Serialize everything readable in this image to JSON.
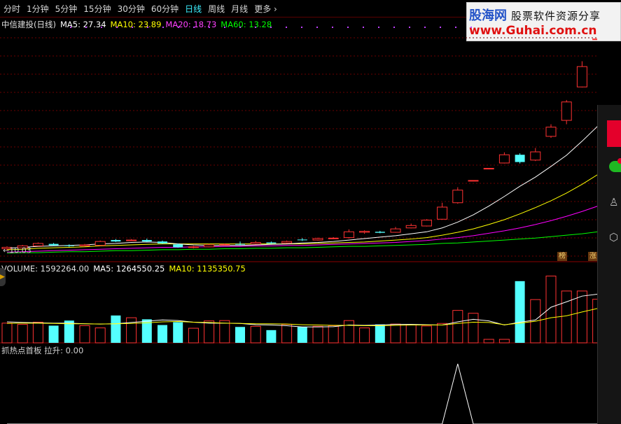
{
  "toolbar": {
    "items": [
      {
        "label": "分时",
        "active": false
      },
      {
        "label": "1分钟",
        "active": false
      },
      {
        "label": "5分钟",
        "active": false
      },
      {
        "label": "15分钟",
        "active": false
      },
      {
        "label": "30分钟",
        "active": false
      },
      {
        "label": "60分钟",
        "active": false
      },
      {
        "label": "日线",
        "active": true
      },
      {
        "label": "周线",
        "active": false
      },
      {
        "label": "月线",
        "active": false
      },
      {
        "label": "更多",
        "active": false
      }
    ]
  },
  "price_panel": {
    "title": "中信建投(日线)",
    "ma5": "MA5: 27.34",
    "ma10": "MA10: 23.89",
    "ma20": "MA20: 18.73",
    "ma60": "MA60: 13.28",
    "low_marker": "←10.03",
    "badges": [
      "榜",
      "涨"
    ]
  },
  "volume_panel": {
    "label": "VOLUME: 1592264.00",
    "ma5": "MA5: 1264550.25",
    "ma10": "MA10: 1135350.75"
  },
  "indicator_panel": {
    "title": "抓热点首板",
    "value": "拉升: 0.00"
  },
  "watermark": {
    "brand": "股海网",
    "subtitle": "股票软件资源分享",
    "url": "www.Guhai.com.cn"
  },
  "colors": {
    "up": "#ff3232",
    "down": "#54ffff",
    "ma5": "#ffffff",
    "ma10": "#ffff00",
    "ma20": "#ff00ff",
    "ma60": "#00ff00",
    "active_tab": "#3cf0ff"
  },
  "chart_data": {
    "type": "candlestick",
    "low_label": 10.03,
    "candles": [
      {
        "o": 10.3,
        "c": 10.6,
        "h": 10.8,
        "l": 10.03
      },
      {
        "o": 10.5,
        "c": 10.9,
        "h": 11.1,
        "l": 10.4
      },
      {
        "o": 10.9,
        "c": 11.4,
        "h": 11.6,
        "l": 10.8
      },
      {
        "o": 11.3,
        "c": 11.0,
        "h": 11.5,
        "l": 10.9
      },
      {
        "o": 11.0,
        "c": 10.9,
        "h": 11.2,
        "l": 10.7
      },
      {
        "o": 10.9,
        "c": 11.1,
        "h": 11.3,
        "l": 10.8
      },
      {
        "o": 11.0,
        "c": 11.8,
        "h": 12.0,
        "l": 10.9
      },
      {
        "o": 12.1,
        "c": 11.8,
        "h": 12.3,
        "l": 11.7
      },
      {
        "o": 12.0,
        "c": 12.1,
        "h": 12.3,
        "l": 11.9
      },
      {
        "o": 12.1,
        "c": 11.8,
        "h": 12.4,
        "l": 11.7
      },
      {
        "o": 11.8,
        "c": 11.4,
        "h": 12.0,
        "l": 11.3
      },
      {
        "o": 11.2,
        "c": 10.6,
        "h": 11.4,
        "l": 10.5
      },
      {
        "o": 10.6,
        "c": 10.7,
        "h": 10.9,
        "l": 10.4
      },
      {
        "o": 10.7,
        "c": 11.1,
        "h": 11.3,
        "l": 10.6
      },
      {
        "o": 11.1,
        "c": 11.2,
        "h": 11.4,
        "l": 11.0
      },
      {
        "o": 11.3,
        "c": 11.2,
        "h": 11.8,
        "l": 11.0
      },
      {
        "o": 11.3,
        "c": 11.6,
        "h": 11.9,
        "l": 11.2
      },
      {
        "o": 11.6,
        "c": 11.4,
        "h": 11.8,
        "l": 11.3
      },
      {
        "o": 11.5,
        "c": 11.8,
        "h": 12.0,
        "l": 11.4
      },
      {
        "o": 12.2,
        "c": 12.1,
        "h": 12.5,
        "l": 11.9
      },
      {
        "o": 12.1,
        "c": 12.4,
        "h": 12.6,
        "l": 12.0
      },
      {
        "o": 12.4,
        "c": 12.5,
        "h": 12.7,
        "l": 12.3
      },
      {
        "o": 12.6,
        "c": 13.8,
        "h": 14.3,
        "l": 12.4
      },
      {
        "o": 13.7,
        "c": 13.9,
        "h": 14.1,
        "l": 13.4
      },
      {
        "o": 13.8,
        "c": 13.6,
        "h": 14.0,
        "l": 13.5
      },
      {
        "o": 13.7,
        "c": 14.4,
        "h": 14.8,
        "l": 13.6
      },
      {
        "o": 14.6,
        "c": 15.1,
        "h": 15.5,
        "l": 14.5
      },
      {
        "o": 15.0,
        "c": 16.2,
        "h": 16.4,
        "l": 14.9
      },
      {
        "o": 16.4,
        "c": 18.9,
        "h": 19.8,
        "l": 16.3
      },
      {
        "o": 19.8,
        "c": 22.4,
        "h": 23.0,
        "l": 19.6
      },
      {
        "o": 24.4,
        "c": 24.4,
        "h": 24.4,
        "l": 24.4
      },
      {
        "o": 26.9,
        "c": 26.9,
        "h": 26.9,
        "l": 26.9
      },
      {
        "o": 28.0,
        "c": 29.7,
        "h": 30.2,
        "l": 27.9
      },
      {
        "o": 29.7,
        "c": 28.2,
        "h": 30.0,
        "l": 27.9
      },
      {
        "o": 28.6,
        "c": 30.3,
        "h": 31.1,
        "l": 28.4
      },
      {
        "o": 33.5,
        "c": 35.4,
        "h": 36.0,
        "l": 33.2
      },
      {
        "o": 36.8,
        "c": 40.6,
        "h": 41.0,
        "l": 36.0
      },
      {
        "o": 43.7,
        "c": 47.9,
        "h": 49.0,
        "l": 43.6
      },
      {
        "o": 53.6,
        "c": 53.6,
        "h": 53.6,
        "l": 50.5
      },
      {
        "o": 50.5,
        "c": 50.5,
        "h": 50.5,
        "l": 43.0
      }
    ],
    "ma5": [
      10.4,
      10.6,
      10.8,
      10.9,
      11.0,
      11.1,
      11.3,
      11.4,
      11.6,
      11.7,
      11.6,
      11.3,
      11.1,
      11.0,
      11.0,
      11.0,
      11.1,
      11.2,
      11.3,
      11.5,
      11.6,
      11.8,
      12.1,
      12.4,
      12.7,
      13.0,
      13.4,
      13.8,
      14.6,
      15.8,
      17.3,
      19.1,
      21.1,
      23.2,
      25.1,
      27.3,
      29.6,
      32.5,
      35.6,
      38.9
    ],
    "ma10": [
      10.1,
      10.2,
      10.4,
      10.5,
      10.6,
      10.7,
      10.9,
      11.0,
      11.1,
      11.2,
      11.3,
      11.3,
      11.3,
      11.3,
      11.3,
      11.3,
      11.3,
      11.3,
      11.3,
      11.3,
      11.4,
      11.5,
      11.6,
      11.7,
      11.9,
      12.1,
      12.3,
      12.6,
      13.1,
      13.7,
      14.4,
      15.3,
      16.3,
      17.5,
      18.8,
      20.2,
      21.8,
      23.6,
      25.6,
      27.9
    ],
    "ma20": [
      9.6,
      9.7,
      9.8,
      9.9,
      10.0,
      10.1,
      10.2,
      10.3,
      10.4,
      10.5,
      10.6,
      10.6,
      10.7,
      10.7,
      10.8,
      10.8,
      10.9,
      10.9,
      11.0,
      11.0,
      11.1,
      11.2,
      11.3,
      11.4,
      11.5,
      11.6,
      11.8,
      12.0,
      12.3,
      12.6,
      13.0,
      13.5,
      14.0,
      14.6,
      15.3,
      16.1,
      17.0,
      18.0,
      19.1,
      20.3
    ],
    "ma60": [
      9.4,
      9.5,
      9.5,
      9.6,
      9.7,
      9.7,
      9.8,
      9.9,
      9.9,
      10.0,
      10.1,
      10.1,
      10.2,
      10.2,
      10.3,
      10.3,
      10.4,
      10.4,
      10.5,
      10.5,
      10.6,
      10.7,
      10.8,
      10.8,
      10.9,
      11.0,
      11.1,
      11.2,
      11.4,
      11.5,
      11.7,
      11.9,
      12.1,
      12.3,
      12.5,
      12.8,
      13.1,
      13.4,
      13.8,
      14.2
    ],
    "volume": [
      620,
      580,
      650,
      540,
      700,
      540,
      470,
      860,
      790,
      740,
      560,
      650,
      460,
      690,
      700,
      500,
      520,
      400,
      580,
      500,
      520,
      540,
      700,
      470,
      580,
      590,
      570,
      530,
      610,
      1020,
      930,
      110,
      110,
      1940,
      1360,
      2100,
      1630,
      1630,
      1370,
      1270
    ],
    "vol_ma5": [
      660,
      640,
      630,
      620,
      620,
      600,
      590,
      600,
      640,
      680,
      720,
      700,
      650,
      620,
      620,
      610,
      570,
      560,
      540,
      500,
      500,
      510,
      560,
      550,
      560,
      580,
      580,
      570,
      560,
      660,
      740,
      690,
      560,
      650,
      720,
      1120,
      1290,
      1470,
      1530,
      1530
    ],
    "vol_ma10": [
      610,
      620,
      620,
      610,
      600,
      600,
      590,
      600,
      610,
      630,
      660,
      670,
      650,
      640,
      620,
      610,
      600,
      600,
      590,
      570,
      560,
      550,
      550,
      540,
      540,
      550,
      560,
      560,
      560,
      610,
      650,
      640,
      570,
      620,
      680,
      790,
      850,
      970,
      1080,
      1160
    ],
    "indicator": [
      0,
      0,
      0,
      0,
      0,
      0,
      0,
      0,
      0,
      0,
      0,
      0,
      0,
      0,
      0,
      0,
      0,
      0,
      0,
      0,
      0,
      0,
      0,
      0,
      0,
      0,
      0,
      0,
      0,
      1,
      0,
      0,
      0,
      0,
      0,
      0,
      0,
      0,
      0,
      0
    ]
  }
}
